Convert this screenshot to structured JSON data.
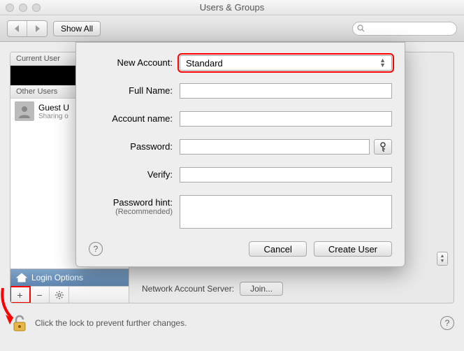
{
  "window": {
    "title": "Users & Groups"
  },
  "toolbar": {
    "show_all": "Show All",
    "search_placeholder": ""
  },
  "sidebar": {
    "current_header": "Current User",
    "other_header": "Other Users",
    "guest": {
      "name": "Guest U",
      "sub": "Sharing o"
    },
    "login_options": "Login Options"
  },
  "right": {
    "nas_label": "Network Account Server:",
    "join": "Join..."
  },
  "lock": {
    "text": "Click the lock to prevent further changes."
  },
  "sheet": {
    "labels": {
      "new_account": "New Account:",
      "full_name": "Full Name:",
      "account_name": "Account name:",
      "password": "Password:",
      "verify": "Verify:",
      "hint": "Password hint:",
      "hint_sub": "(Recommended)"
    },
    "account_type": "Standard",
    "buttons": {
      "cancel": "Cancel",
      "create": "Create User"
    }
  }
}
